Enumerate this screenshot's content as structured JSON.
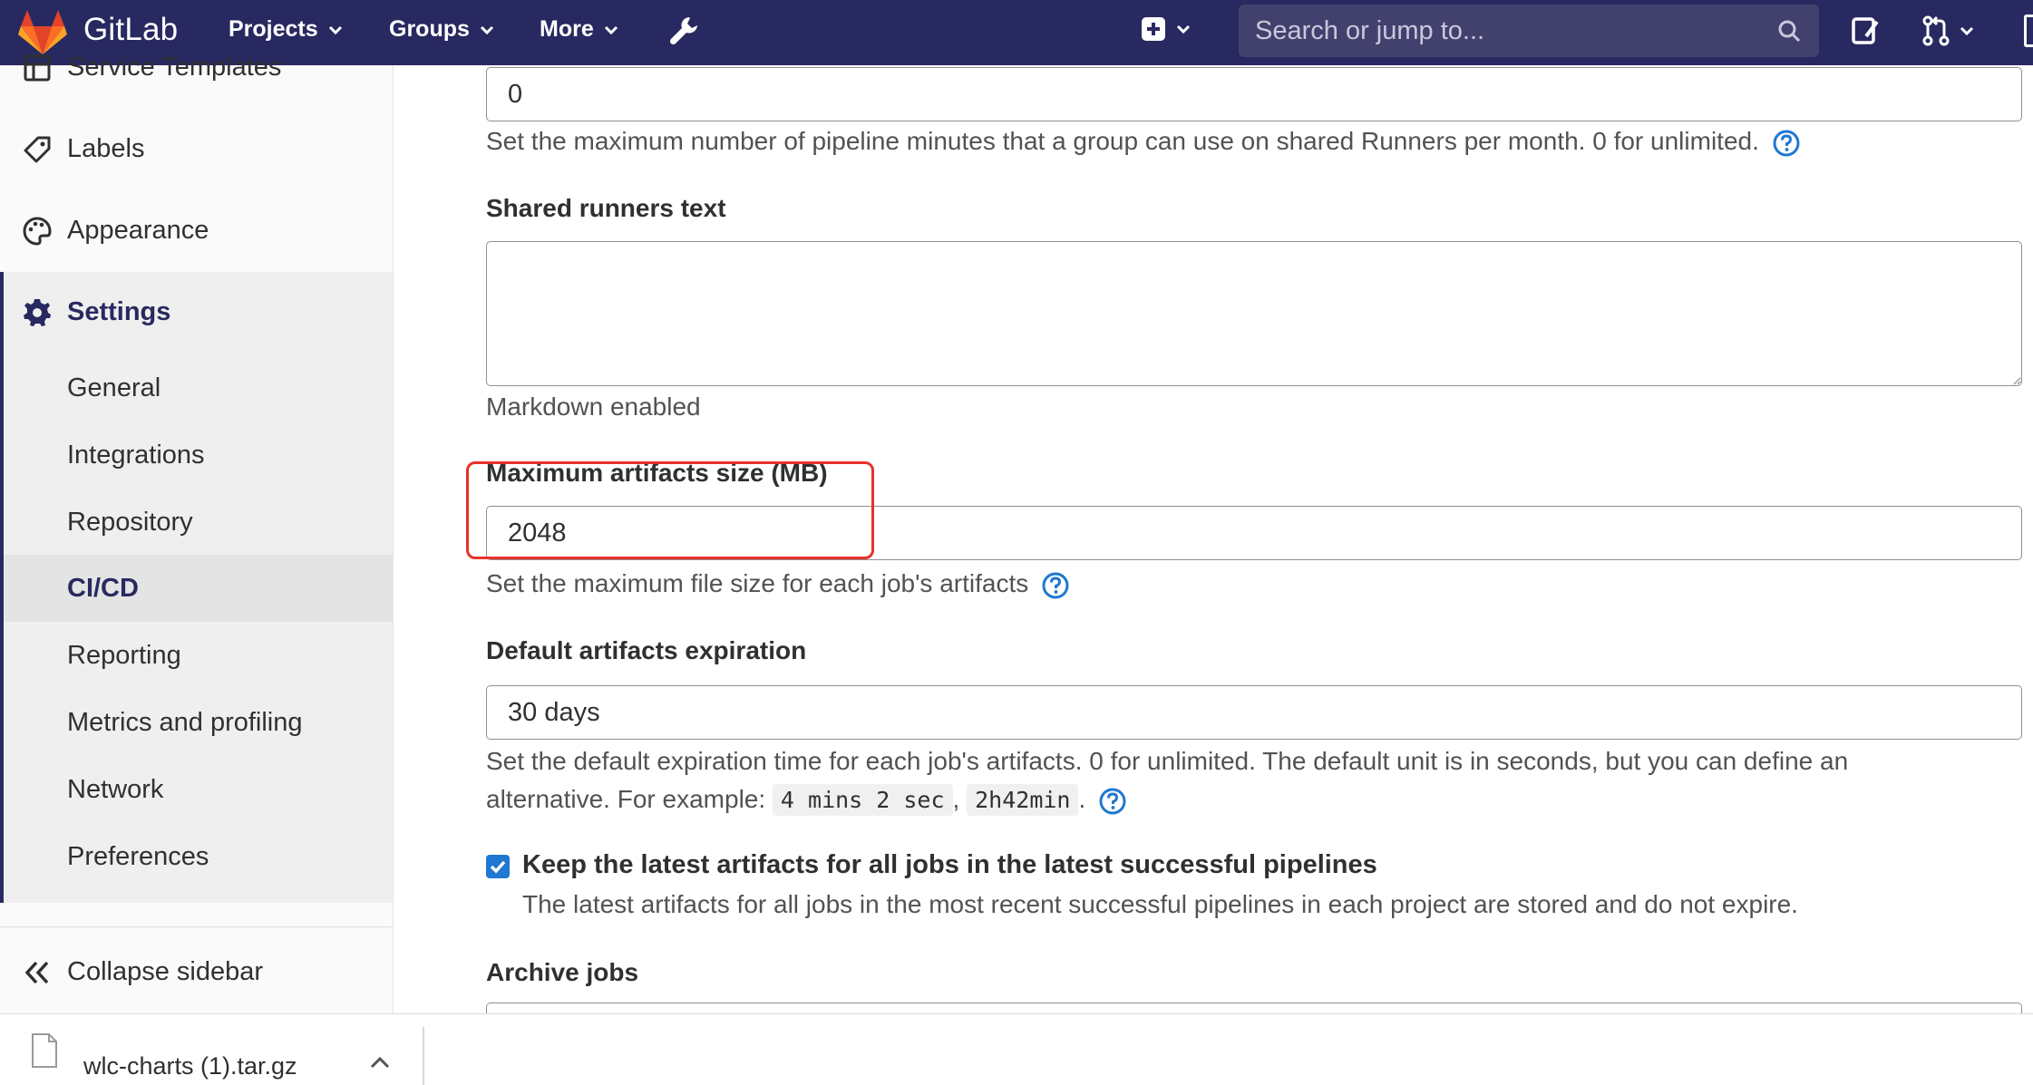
{
  "navbar": {
    "brand": "GitLab",
    "menus": [
      {
        "label": "Projects"
      },
      {
        "label": "Groups"
      },
      {
        "label": "More"
      }
    ],
    "search_placeholder": "Search or jump to..."
  },
  "sidebar": {
    "items": [
      {
        "label": "Service Templates",
        "icon": "template-icon"
      },
      {
        "label": "Labels",
        "icon": "tag-icon"
      },
      {
        "label": "Appearance",
        "icon": "palette-icon"
      },
      {
        "label": "Settings",
        "icon": "gear-icon",
        "active": true
      }
    ],
    "subitems": [
      {
        "label": "General"
      },
      {
        "label": "Integrations"
      },
      {
        "label": "Repository"
      },
      {
        "label": "CI/CD",
        "active": true
      },
      {
        "label": "Reporting"
      },
      {
        "label": "Metrics and profiling"
      },
      {
        "label": "Network"
      },
      {
        "label": "Preferences"
      }
    ],
    "collapse_label": "Collapse sidebar"
  },
  "form": {
    "pipeline_minutes": {
      "value": "0",
      "help": "Set the maximum number of pipeline minutes that a group can use on shared Runners per month. 0 for unlimited."
    },
    "shared_runners_text": {
      "label": "Shared runners text",
      "value": "",
      "help": "Markdown enabled"
    },
    "max_artifacts_size": {
      "label": "Maximum artifacts size (MB)",
      "value": "2048",
      "help": "Set the maximum file size for each job's artifacts"
    },
    "default_artifacts_expiration": {
      "label": "Default artifacts expiration",
      "value": "30 days",
      "help_line1": "Set the default expiration time for each job's artifacts. 0 for unlimited. The default unit is in seconds, but you can define an",
      "help_line2_prefix": "alternative. For example:",
      "example1": "4 mins 2 sec",
      "example_sep": ",",
      "example2": "2h42min",
      "help_line2_suffix": "."
    },
    "keep_latest_artifacts": {
      "checked": true,
      "label": "Keep the latest artifacts for all jobs in the latest successful pipelines",
      "help": "The latest artifacts for all jobs in the most recent successful pipelines in each project are stored and do not expire."
    },
    "archive_jobs": {
      "label": "Archive jobs"
    }
  },
  "download_bar": {
    "filename": "wlc-charts (1).tar.gz"
  },
  "colors": {
    "navbar_bg": "#292961",
    "accent_blue": "#1f78d1",
    "highlight_red": "#e8322b"
  }
}
